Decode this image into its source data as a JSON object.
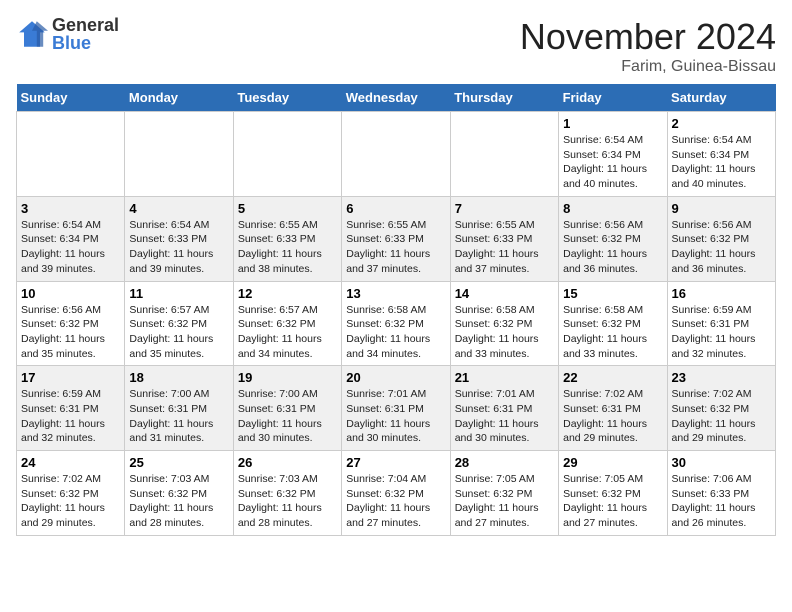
{
  "logo": {
    "general": "General",
    "blue": "Blue"
  },
  "title": "November 2024",
  "location": "Farim, Guinea-Bissau",
  "days_header": [
    "Sunday",
    "Monday",
    "Tuesday",
    "Wednesday",
    "Thursday",
    "Friday",
    "Saturday"
  ],
  "weeks": [
    [
      {
        "day": "",
        "info": ""
      },
      {
        "day": "",
        "info": ""
      },
      {
        "day": "",
        "info": ""
      },
      {
        "day": "",
        "info": ""
      },
      {
        "day": "",
        "info": ""
      },
      {
        "day": "1",
        "info": "Sunrise: 6:54 AM\nSunset: 6:34 PM\nDaylight: 11 hours\nand 40 minutes."
      },
      {
        "day": "2",
        "info": "Sunrise: 6:54 AM\nSunset: 6:34 PM\nDaylight: 11 hours\nand 40 minutes."
      }
    ],
    [
      {
        "day": "3",
        "info": "Sunrise: 6:54 AM\nSunset: 6:34 PM\nDaylight: 11 hours\nand 39 minutes."
      },
      {
        "day": "4",
        "info": "Sunrise: 6:54 AM\nSunset: 6:33 PM\nDaylight: 11 hours\nand 39 minutes."
      },
      {
        "day": "5",
        "info": "Sunrise: 6:55 AM\nSunset: 6:33 PM\nDaylight: 11 hours\nand 38 minutes."
      },
      {
        "day": "6",
        "info": "Sunrise: 6:55 AM\nSunset: 6:33 PM\nDaylight: 11 hours\nand 37 minutes."
      },
      {
        "day": "7",
        "info": "Sunrise: 6:55 AM\nSunset: 6:33 PM\nDaylight: 11 hours\nand 37 minutes."
      },
      {
        "day": "8",
        "info": "Sunrise: 6:56 AM\nSunset: 6:32 PM\nDaylight: 11 hours\nand 36 minutes."
      },
      {
        "day": "9",
        "info": "Sunrise: 6:56 AM\nSunset: 6:32 PM\nDaylight: 11 hours\nand 36 minutes."
      }
    ],
    [
      {
        "day": "10",
        "info": "Sunrise: 6:56 AM\nSunset: 6:32 PM\nDaylight: 11 hours\nand 35 minutes."
      },
      {
        "day": "11",
        "info": "Sunrise: 6:57 AM\nSunset: 6:32 PM\nDaylight: 11 hours\nand 35 minutes."
      },
      {
        "day": "12",
        "info": "Sunrise: 6:57 AM\nSunset: 6:32 PM\nDaylight: 11 hours\nand 34 minutes."
      },
      {
        "day": "13",
        "info": "Sunrise: 6:58 AM\nSunset: 6:32 PM\nDaylight: 11 hours\nand 34 minutes."
      },
      {
        "day": "14",
        "info": "Sunrise: 6:58 AM\nSunset: 6:32 PM\nDaylight: 11 hours\nand 33 minutes."
      },
      {
        "day": "15",
        "info": "Sunrise: 6:58 AM\nSunset: 6:32 PM\nDaylight: 11 hours\nand 33 minutes."
      },
      {
        "day": "16",
        "info": "Sunrise: 6:59 AM\nSunset: 6:31 PM\nDaylight: 11 hours\nand 32 minutes."
      }
    ],
    [
      {
        "day": "17",
        "info": "Sunrise: 6:59 AM\nSunset: 6:31 PM\nDaylight: 11 hours\nand 32 minutes."
      },
      {
        "day": "18",
        "info": "Sunrise: 7:00 AM\nSunset: 6:31 PM\nDaylight: 11 hours\nand 31 minutes."
      },
      {
        "day": "19",
        "info": "Sunrise: 7:00 AM\nSunset: 6:31 PM\nDaylight: 11 hours\nand 30 minutes."
      },
      {
        "day": "20",
        "info": "Sunrise: 7:01 AM\nSunset: 6:31 PM\nDaylight: 11 hours\nand 30 minutes."
      },
      {
        "day": "21",
        "info": "Sunrise: 7:01 AM\nSunset: 6:31 PM\nDaylight: 11 hours\nand 30 minutes."
      },
      {
        "day": "22",
        "info": "Sunrise: 7:02 AM\nSunset: 6:31 PM\nDaylight: 11 hours\nand 29 minutes."
      },
      {
        "day": "23",
        "info": "Sunrise: 7:02 AM\nSunset: 6:32 PM\nDaylight: 11 hours\nand 29 minutes."
      }
    ],
    [
      {
        "day": "24",
        "info": "Sunrise: 7:02 AM\nSunset: 6:32 PM\nDaylight: 11 hours\nand 29 minutes."
      },
      {
        "day": "25",
        "info": "Sunrise: 7:03 AM\nSunset: 6:32 PM\nDaylight: 11 hours\nand 28 minutes."
      },
      {
        "day": "26",
        "info": "Sunrise: 7:03 AM\nSunset: 6:32 PM\nDaylight: 11 hours\nand 28 minutes."
      },
      {
        "day": "27",
        "info": "Sunrise: 7:04 AM\nSunset: 6:32 PM\nDaylight: 11 hours\nand 27 minutes."
      },
      {
        "day": "28",
        "info": "Sunrise: 7:05 AM\nSunset: 6:32 PM\nDaylight: 11 hours\nand 27 minutes."
      },
      {
        "day": "29",
        "info": "Sunrise: 7:05 AM\nSunset: 6:32 PM\nDaylight: 11 hours\nand 27 minutes."
      },
      {
        "day": "30",
        "info": "Sunrise: 7:06 AM\nSunset: 6:33 PM\nDaylight: 11 hours\nand 26 minutes."
      }
    ]
  ]
}
